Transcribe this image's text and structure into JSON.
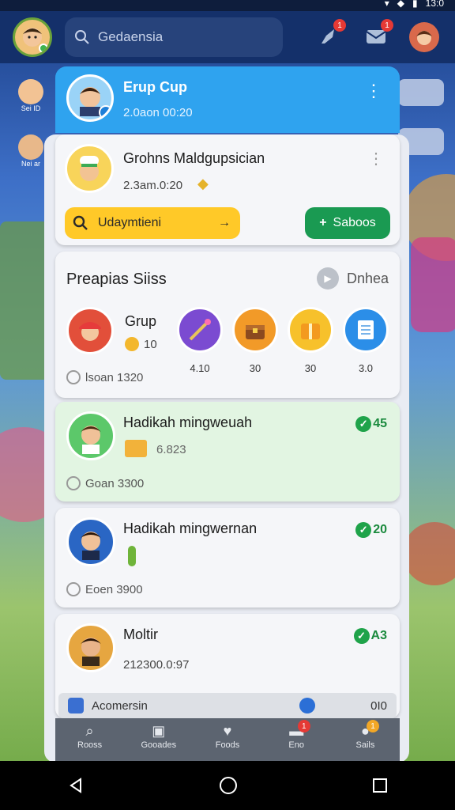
{
  "status_bar": {
    "time": "13:0"
  },
  "top_bar": {
    "search_placeholder": "Gedaensia",
    "notifications": [
      {
        "icon": "rocket-icon",
        "badge": "1"
      },
      {
        "icon": "mail-icon",
        "badge": "1"
      },
      {
        "icon": "profile-avatar-icon",
        "badge": ""
      }
    ]
  },
  "background": {
    "side_chips": [
      {
        "label": "Sei ID"
      },
      {
        "label": "Nei ar"
      }
    ]
  },
  "group_header": {
    "title": "Erup Cup",
    "time": "2.0aon 00:20"
  },
  "post": {
    "title": "Grohns Maldgupsician",
    "time": "2.3am.0:20",
    "primary_button": "Udaymtieni",
    "secondary_button": "Saboos"
  },
  "suggestions": {
    "title": "Preapias Siiss",
    "more_label": "Dnhea",
    "first_item": {
      "name": "Grup",
      "coins": "10"
    },
    "games": [
      {
        "icon": "magic-wand-icon",
        "stat": "4.10"
      },
      {
        "icon": "treasure-chest-icon",
        "stat": "30"
      },
      {
        "icon": "gift-box-icon",
        "stat": "30"
      },
      {
        "icon": "document-icon",
        "stat": "3.0"
      }
    ],
    "footer": "lsoan 1320"
  },
  "feed": [
    {
      "title": "Hadikah mingweuah",
      "detail": "6.823",
      "score": "45",
      "footer": "Goan 3300",
      "highlight": true
    },
    {
      "title": "Hadikah mingwernan",
      "detail": "",
      "score": "20",
      "footer": "Eoen 3900",
      "highlight": false
    },
    {
      "title": "Moltir",
      "detail": "212300.0:97",
      "score": "A3",
      "footer": "",
      "highlight": false
    }
  ],
  "bottom_strip": {
    "label": "Acomersin",
    "value": "0I0"
  },
  "tabs": [
    {
      "label": "Rooss",
      "icon": "search-icon"
    },
    {
      "label": "Gooades",
      "icon": "camera-icon"
    },
    {
      "label": "Foods",
      "icon": "heart-icon"
    },
    {
      "label": "Eno",
      "icon": "inbox-icon",
      "badge": "1"
    },
    {
      "label": "Sails",
      "icon": "person-icon",
      "badge": "1"
    }
  ],
  "colors": {
    "header_blue": "#2fa3ef",
    "accent_yellow": "#ffc928",
    "accent_green": "#1fa34a"
  }
}
